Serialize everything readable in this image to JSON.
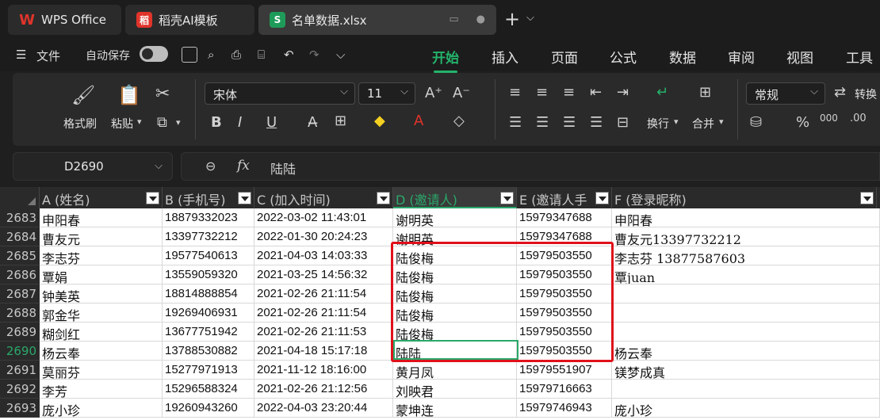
{
  "tabs": [
    {
      "label": "WPS Office",
      "logo": "W"
    },
    {
      "label": "稻壳AI模板",
      "logo": "稻"
    },
    {
      "label": "名单数据.xlsx",
      "logo": "S"
    }
  ],
  "menu": {
    "file_label": "文件",
    "autosave_label": "自动保存",
    "tabs": [
      "开始",
      "插入",
      "页面",
      "公式",
      "数据",
      "审阅",
      "视图",
      "工具"
    ],
    "active_tab": "开始"
  },
  "ribbon": {
    "format_painter": "格式刷",
    "paste": "粘贴",
    "font_name": "宋体",
    "font_size": "11",
    "wrap": "换行",
    "merge": "合并",
    "number_format": "常规",
    "convert": "转换"
  },
  "formula_bar": {
    "name_box": "D2690",
    "fx_label": "fx",
    "value": "陆陆"
  },
  "columns": [
    {
      "label": "A (姓名)",
      "filter": true
    },
    {
      "label": "B (手机号)",
      "filter": true
    },
    {
      "label": "C (加入时间)",
      "filter": true
    },
    {
      "label": "D (邀请人)",
      "filter": true,
      "selected": true
    },
    {
      "label": "E (邀请人手",
      "filter": true
    },
    {
      "label": "F (登录昵称)",
      "filter": true
    }
  ],
  "rows": [
    {
      "num": "2683",
      "cells": [
        "申阳春",
        "18879332023",
        "2022-03-02 11:43:01",
        "谢明英",
        "15979347688",
        "申阳春"
      ]
    },
    {
      "num": "2684",
      "cells": [
        "曹友元",
        "13397732212",
        "2022-01-30 20:24:23",
        "谢明英",
        "15979347688",
        "曹友元13397732212"
      ]
    },
    {
      "num": "2685",
      "cells": [
        "李志芬",
        "19577540613",
        "2021-04-03 14:03:33",
        "陆俊梅",
        "15979503550",
        "李志芬 13877587603"
      ]
    },
    {
      "num": "2686",
      "cells": [
        "覃娟",
        "13559059320",
        "2021-03-25 14:56:32",
        "陆俊梅",
        "15979503550",
        "覃juan"
      ]
    },
    {
      "num": "2687",
      "cells": [
        "钟美英",
        "18814888854",
        "2021-02-26 21:11:54",
        "陆俊梅",
        "15979503550",
        ""
      ]
    },
    {
      "num": "2688",
      "cells": [
        "郭金华",
        "19269406931",
        "2021-02-26 21:11:54",
        "陆俊梅",
        "15979503550",
        ""
      ]
    },
    {
      "num": "2689",
      "cells": [
        "糊剑红",
        "13677751942",
        "2021-02-26 21:11:53",
        "陆俊梅",
        "15979503550",
        ""
      ]
    },
    {
      "num": "2690",
      "cells": [
        "杨云奉",
        "13788530882",
        "2021-04-18 15:17:18",
        "陆陆",
        "15979503550",
        "杨云奉"
      ],
      "selected": true
    },
    {
      "num": "2691",
      "cells": [
        "莫丽芬",
        "15277971913",
        "2021-11-12 18:16:00",
        "黄月凤",
        "15979551907",
        "镁梦成真"
      ]
    },
    {
      "num": "2692",
      "cells": [
        "李芳",
        "15296588324",
        "2021-02-26 21:12:56",
        "刘映君",
        "15979716663",
        ""
      ]
    },
    {
      "num": "2693",
      "cells": [
        "庞小珍",
        "19260943260",
        "2022-04-03 23:20:44",
        "蒙坤连",
        "15979746943",
        "庞小珍"
      ]
    }
  ],
  "colors": {
    "accent": "#24b36b",
    "highlight_box": "#e0101a"
  }
}
